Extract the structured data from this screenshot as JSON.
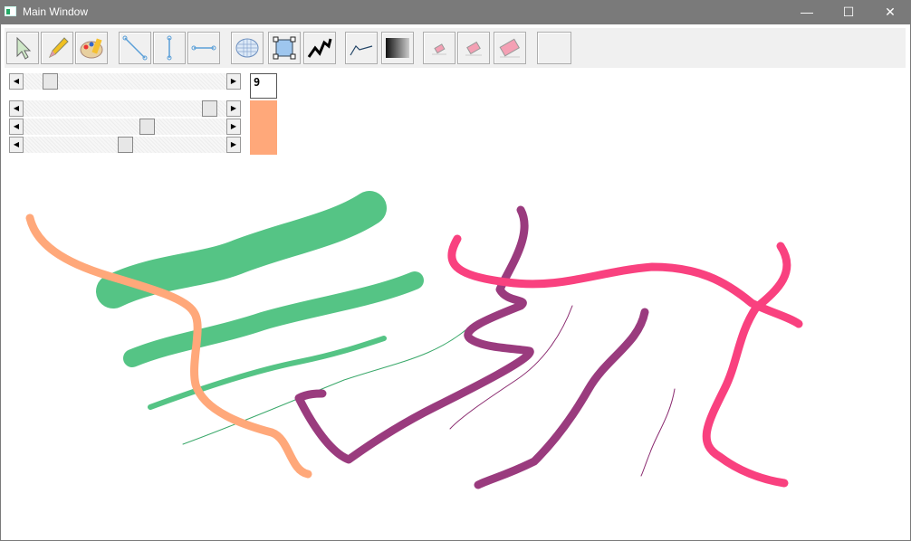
{
  "window": {
    "title": "Main Window",
    "minimize": "—",
    "maximize": "☐",
    "close": "✕"
  },
  "toolbar": {
    "tools": [
      {
        "name": "select-tool",
        "icon": "arrow-cursor-icon"
      },
      {
        "name": "pencil-tool",
        "icon": "pencil-icon"
      },
      {
        "name": "palette-tool",
        "icon": "paint-palette-icon"
      },
      {
        "name": "diagonal-line-tool",
        "icon": "diagonal-line-icon"
      },
      {
        "name": "vertical-line-tool",
        "icon": "vertical-line-icon"
      },
      {
        "name": "horizontal-line-tool",
        "icon": "horizontal-line-icon"
      },
      {
        "name": "ellipse-tool",
        "icon": "ellipse-grid-icon"
      },
      {
        "name": "rectangle-select-tool",
        "icon": "selection-rectangle-icon"
      },
      {
        "name": "zigzag-tool",
        "icon": "zigzag-line-icon"
      },
      {
        "name": "curve-tool",
        "icon": "polyline-icon"
      },
      {
        "name": "gradient-tool",
        "icon": "gradient-icon"
      },
      {
        "name": "small-eraser-tool",
        "icon": "small-eraser-icon"
      },
      {
        "name": "medium-eraser-tool",
        "icon": "medium-eraser-icon"
      },
      {
        "name": "large-eraser-tool",
        "icon": "large-eraser-icon"
      },
      {
        "name": "blank-tool",
        "icon": ""
      }
    ]
  },
  "controls": {
    "brush_size": "9",
    "brush_size_level": 0.1,
    "red_level": 0.95,
    "green_level": 0.62,
    "blue_level": 0.5,
    "current_color": "#ffa87a"
  },
  "colors": {
    "green": "#55c485",
    "orange": "#ffa87a",
    "purple": "#9a3b7e",
    "pink": "#f9417f",
    "thin_green": "#3aa86a",
    "thin_purple": "#8a2a6f"
  }
}
